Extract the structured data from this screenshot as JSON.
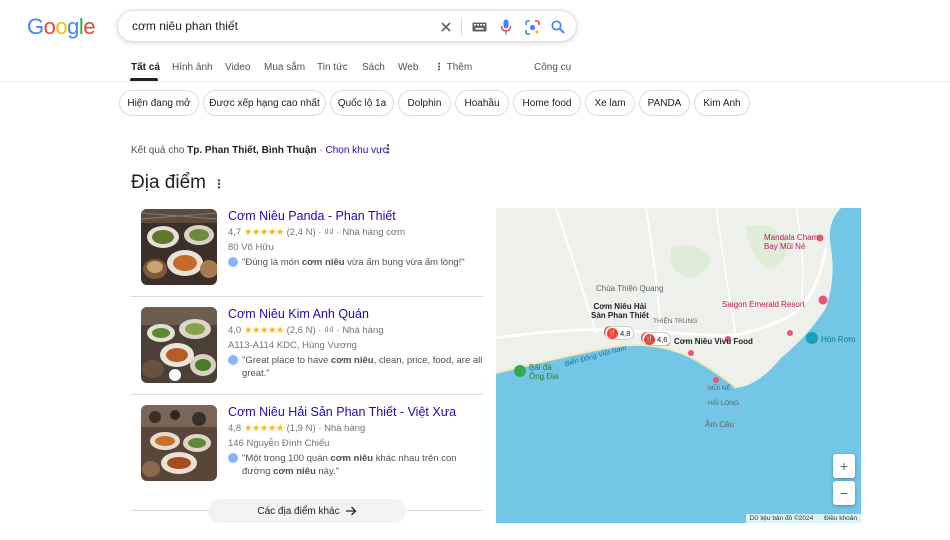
{
  "logo": {
    "letters": [
      "G",
      "o",
      "o",
      "g",
      "l",
      "e"
    ],
    "colors": [
      "#4285f4",
      "#ea4335",
      "#fbbc05",
      "#4285f4",
      "#34a853",
      "#ea4335"
    ]
  },
  "search": {
    "query": "cơm niêu phan thiết"
  },
  "tabs": [
    "Tất cả",
    "Hình ảnh",
    "Video",
    "Mua sắm",
    "Tin tức",
    "Sách",
    "Web",
    "Thêm"
  ],
  "tools_label": "Công cụ",
  "chips": [
    "Hiện đang mở",
    "Được xếp hạng cao nhất",
    "Quốc lộ 1a",
    "Dolphin",
    "Hoahầu",
    "Home food",
    "Xe lam",
    "PANDA",
    "Kim Anh"
  ],
  "location": {
    "prefix": "Kết quả cho",
    "place": "Tp. Phan Thiết, Bình Thuận",
    "sep": " · ",
    "change": "Chọn khu vực"
  },
  "section_title": "Địa điểm",
  "places": [
    {
      "name": "Cơm Niêu Panda - Phan Thiết",
      "rating": "4,7",
      "stars": "★★★★★",
      "reviews": "(2,4 N)",
      "price": "₫₫",
      "category": "Nhà hàng cơm",
      "address": "80 Võ Hữu",
      "review_pre": "\"Đúng là món ",
      "review_bold": "cơm niêu",
      "review_post": " vừa ấm bụng vừa ấm lòng!\""
    },
    {
      "name": "Cơm Niêu Kim Anh Quán",
      "rating": "4,0",
      "stars": "★★★★★",
      "reviews": "(2,6 N)",
      "price": "₫₫",
      "category": "Nhà hàng",
      "address": "A113-A114 KDC, Hùng Vương",
      "review_pre": "\"Great place to have ",
      "review_bold": "cơm niêu",
      "review_post": ", clean, price, food, are all great.\""
    },
    {
      "name": "Cơm Niêu Hải Sản Phan Thiết - Việt Xưa",
      "rating": "4,8",
      "stars": "★★★★★",
      "reviews": "(1,9 N)",
      "price": "",
      "category": "Nhà hàng",
      "address": "146 Nguyễn Đình Chiểu",
      "review_pre": "\"Một trong 100 quán ",
      "review_bold": "cơm niêu",
      "review_mid": " khác nhau trên con đường ",
      "review_bold2": "cơm niêu",
      "review_post": " này.\""
    }
  ],
  "more_places": "Các địa điểm khác",
  "map": {
    "labels": {
      "mandala": "Mandala Cham\nBay Mũi Né",
      "chua": "Chùa Thiện Quang",
      "comnieu_hai": "Cơm Niêu Hải\nSản Phan Thiết",
      "thien_trung": "THIỆN TRUNG",
      "saigon": "Saigon Emerald Resort",
      "vivu": "Cơm Niêu Vivu Food",
      "hon_rom": "Hòn Rơm",
      "bai_da": "Bãi đá\nÔng Địa",
      "bien_dong": "Biển Đông Việt Nam",
      "mui_ne": "MŨI NÉ",
      "hai_long": "HẢI LONG",
      "am_cau": "Âm Câu"
    },
    "pin1": "4,8",
    "pin2": "4,6",
    "footer_data": "Dữ liệu bản đồ ©2024",
    "footer_terms": "Điều khoản",
    "zoom_in": "+",
    "zoom_out": "−"
  }
}
